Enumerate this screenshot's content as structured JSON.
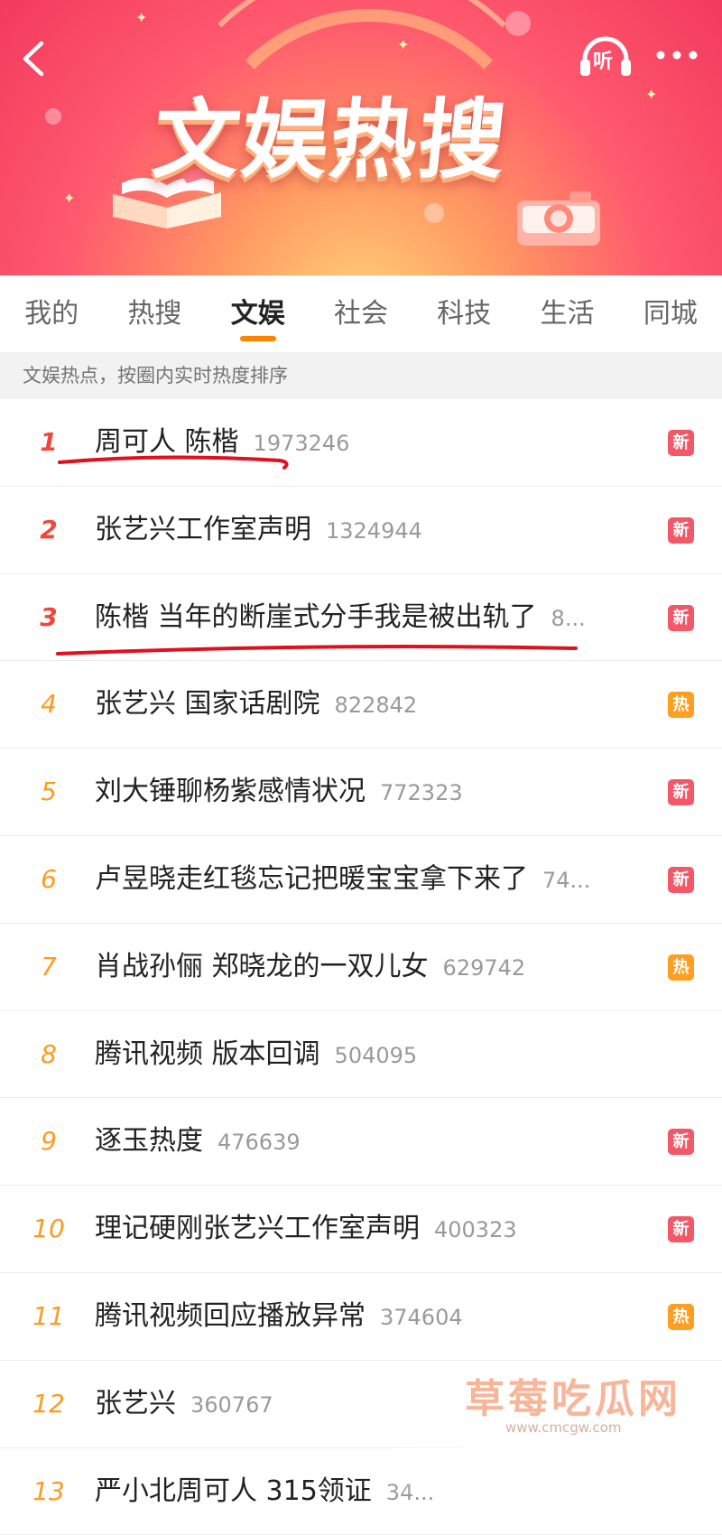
{
  "banner": {
    "title": "文娱热搜",
    "listen_icon_label": "听",
    "colors": {
      "top": "#f23a5e",
      "glow": "#ffd27a"
    }
  },
  "tabs": [
    {
      "label": "我的",
      "active": false
    },
    {
      "label": "热搜",
      "active": false
    },
    {
      "label": "文娱",
      "active": true
    },
    {
      "label": "社会",
      "active": false
    },
    {
      "label": "科技",
      "active": false
    },
    {
      "label": "生活",
      "active": false
    },
    {
      "label": "同城",
      "active": false
    }
  ],
  "subtitle": "文娱热点，按圈内实时热度排序",
  "items": [
    {
      "rank": "1",
      "title": "周可人 陈楷",
      "count": "1973246",
      "badge": "新",
      "badge_type": "new"
    },
    {
      "rank": "2",
      "title": "张艺兴工作室声明",
      "count": "1324944",
      "badge": "新",
      "badge_type": "new"
    },
    {
      "rank": "3",
      "title": "陈楷 当年的断崖式分手我是被出轨了",
      "count": "8...",
      "badge": "新",
      "badge_type": "new"
    },
    {
      "rank": "4",
      "title": "张艺兴 国家话剧院",
      "count": "822842",
      "badge": "热",
      "badge_type": "hot"
    },
    {
      "rank": "5",
      "title": "刘大锤聊杨紫感情状况",
      "count": "772323",
      "badge": "新",
      "badge_type": "new"
    },
    {
      "rank": "6",
      "title": "卢昱晓走红毯忘记把暖宝宝拿下来了",
      "count": "74...",
      "badge": "新",
      "badge_type": "new"
    },
    {
      "rank": "7",
      "title": "肖战孙俪 郑晓龙的一双儿女",
      "count": "629742",
      "badge": "热",
      "badge_type": "hot"
    },
    {
      "rank": "8",
      "title": "腾讯视频 版本回调",
      "count": "504095",
      "badge": "",
      "badge_type": "none"
    },
    {
      "rank": "9",
      "title": "逐玉热度",
      "count": "476639",
      "badge": "新",
      "badge_type": "new"
    },
    {
      "rank": "10",
      "title": "理记硬刚张艺兴工作室声明",
      "count": "400323",
      "badge": "新",
      "badge_type": "new"
    },
    {
      "rank": "11",
      "title": "腾讯视频回应播放异常",
      "count": "374604",
      "badge": "热",
      "badge_type": "hot"
    },
    {
      "rank": "12",
      "title": "张艺兴",
      "count": "360767",
      "badge": "",
      "badge_type": "none"
    },
    {
      "rank": "13",
      "title": "严小北周可人 315领证",
      "count": "34...",
      "badge": "",
      "badge_type": "none"
    }
  ],
  "badge_colors": {
    "new": "#f25868",
    "hot": "#ff9e1f"
  },
  "rank_colors": {
    "top3": "#f2463a",
    "rest": "#ff9a1f"
  },
  "watermark": {
    "text": "草莓吃瓜网",
    "sub": "www.cmcgw.com"
  }
}
